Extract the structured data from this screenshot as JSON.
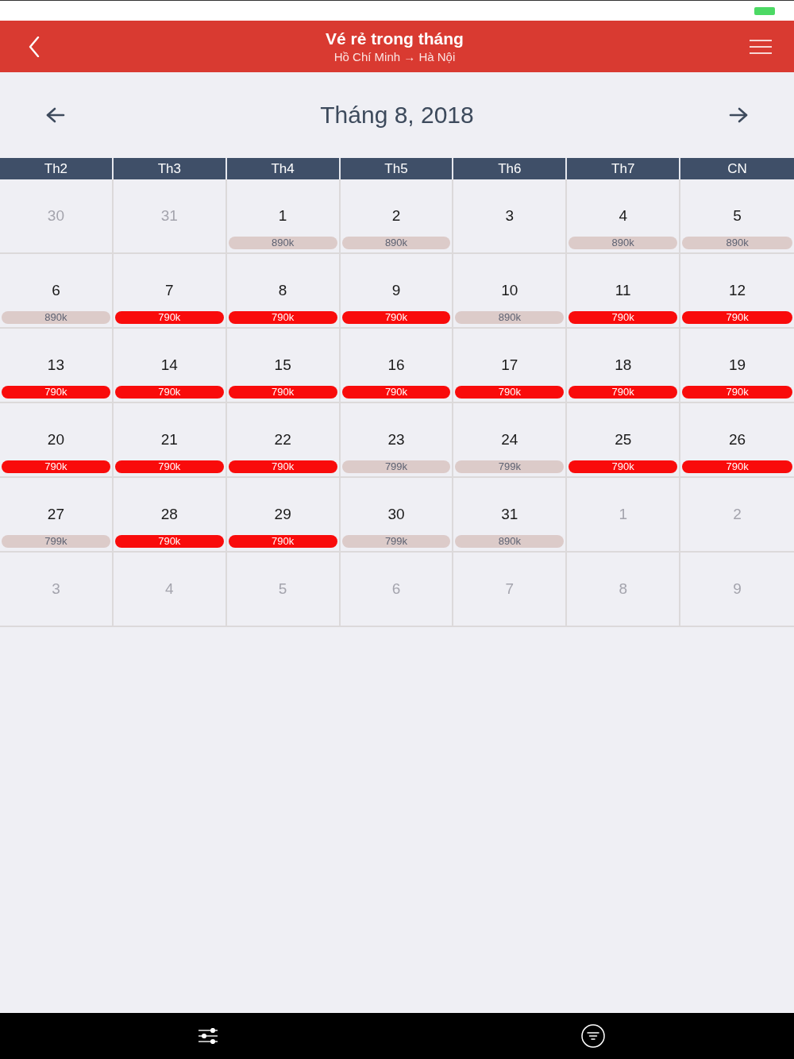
{
  "header": {
    "title": "Vé rẻ trong tháng",
    "subtitle": "Hồ Chí Minh → Hà Nội"
  },
  "month": {
    "title": "Tháng 8, 2018"
  },
  "weekdays": [
    "Th2",
    "Th3",
    "Th4",
    "Th5",
    "Th6",
    "Th7",
    "CN"
  ],
  "days": [
    {
      "day": "30",
      "in_month": false
    },
    {
      "day": "31",
      "in_month": false
    },
    {
      "day": "1",
      "in_month": true,
      "price": "890k",
      "cheapest": false
    },
    {
      "day": "2",
      "in_month": true,
      "price": "890k",
      "cheapest": false
    },
    {
      "day": "3",
      "in_month": true
    },
    {
      "day": "4",
      "in_month": true,
      "price": "890k",
      "cheapest": false
    },
    {
      "day": "5",
      "in_month": true,
      "price": "890k",
      "cheapest": false
    },
    {
      "day": "6",
      "in_month": true,
      "price": "890k",
      "cheapest": false
    },
    {
      "day": "7",
      "in_month": true,
      "price": "790k",
      "cheapest": true
    },
    {
      "day": "8",
      "in_month": true,
      "price": "790k",
      "cheapest": true
    },
    {
      "day": "9",
      "in_month": true,
      "price": "790k",
      "cheapest": true
    },
    {
      "day": "10",
      "in_month": true,
      "price": "890k",
      "cheapest": false
    },
    {
      "day": "11",
      "in_month": true,
      "price": "790k",
      "cheapest": true
    },
    {
      "day": "12",
      "in_month": true,
      "price": "790k",
      "cheapest": true
    },
    {
      "day": "13",
      "in_month": true,
      "price": "790k",
      "cheapest": true
    },
    {
      "day": "14",
      "in_month": true,
      "price": "790k",
      "cheapest": true
    },
    {
      "day": "15",
      "in_month": true,
      "price": "790k",
      "cheapest": true
    },
    {
      "day": "16",
      "in_month": true,
      "price": "790k",
      "cheapest": true
    },
    {
      "day": "17",
      "in_month": true,
      "price": "790k",
      "cheapest": true
    },
    {
      "day": "18",
      "in_month": true,
      "price": "790k",
      "cheapest": true
    },
    {
      "day": "19",
      "in_month": true,
      "price": "790k",
      "cheapest": true
    },
    {
      "day": "20",
      "in_month": true,
      "price": "790k",
      "cheapest": true
    },
    {
      "day": "21",
      "in_month": true,
      "price": "790k",
      "cheapest": true
    },
    {
      "day": "22",
      "in_month": true,
      "price": "790k",
      "cheapest": true
    },
    {
      "day": "23",
      "in_month": true,
      "price": "799k",
      "cheapest": false
    },
    {
      "day": "24",
      "in_month": true,
      "price": "799k",
      "cheapest": false
    },
    {
      "day": "25",
      "in_month": true,
      "price": "790k",
      "cheapest": true
    },
    {
      "day": "26",
      "in_month": true,
      "price": "790k",
      "cheapest": true
    },
    {
      "day": "27",
      "in_month": true,
      "price": "799k",
      "cheapest": false
    },
    {
      "day": "28",
      "in_month": true,
      "price": "790k",
      "cheapest": true
    },
    {
      "day": "29",
      "in_month": true,
      "price": "790k",
      "cheapest": true
    },
    {
      "day": "30",
      "in_month": true,
      "price": "799k",
      "cheapest": false
    },
    {
      "day": "31",
      "in_month": true,
      "price": "890k",
      "cheapest": false
    },
    {
      "day": "1",
      "in_month": false
    },
    {
      "day": "2",
      "in_month": false
    },
    {
      "day": "3",
      "in_month": false
    },
    {
      "day": "4",
      "in_month": false
    },
    {
      "day": "5",
      "in_month": false
    },
    {
      "day": "6",
      "in_month": false
    },
    {
      "day": "7",
      "in_month": false
    },
    {
      "day": "8",
      "in_month": false
    },
    {
      "day": "9",
      "in_month": false
    }
  ]
}
